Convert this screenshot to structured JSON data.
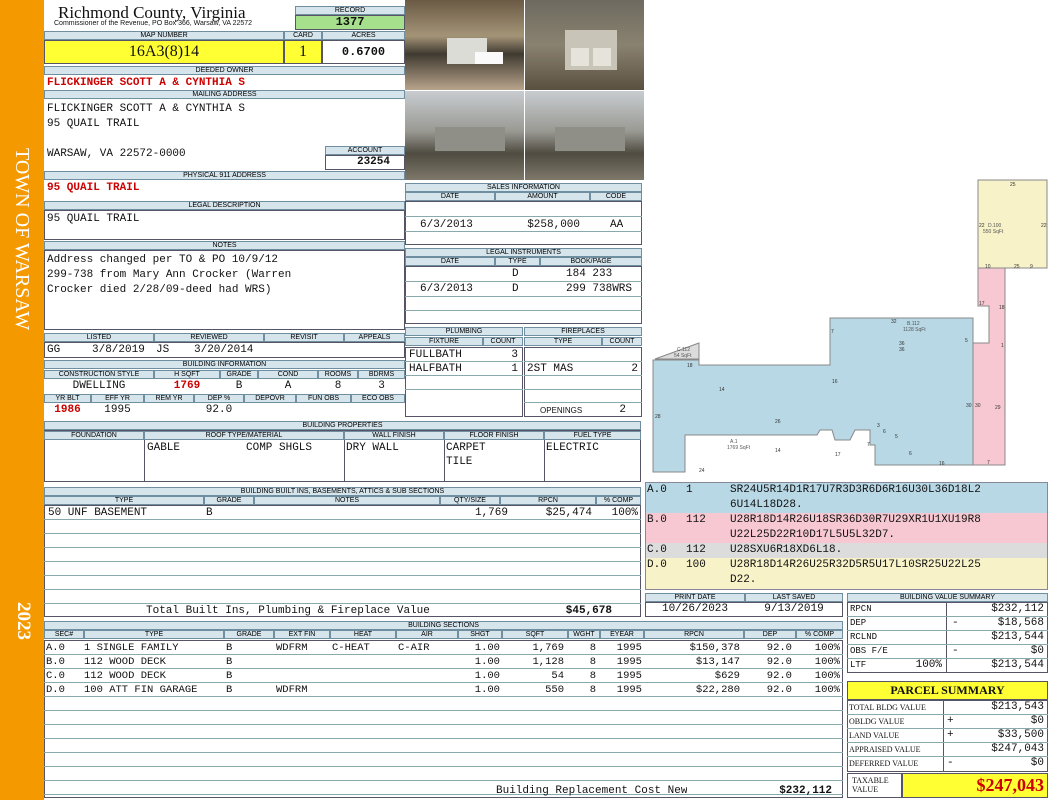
{
  "sidebar": {
    "town": "TOWN OF WARSAW",
    "year": "2023"
  },
  "header": {
    "county": "Richmond County, Virginia",
    "commissioner": "Commissioner of the Revenue, PO Box 366, Warsaw, VA 22572",
    "record_label": "RECORD",
    "record": "1377",
    "map_label": "MAP NUMBER",
    "map_number": "16A3(8)14",
    "card_label": "CARD",
    "card": "1",
    "acres_label": "ACRES",
    "acres": "0.6700"
  },
  "owner": {
    "label": "DEEDED OWNER",
    "name": "FLICKINGER SCOTT A & CYNTHIA S"
  },
  "mailing": {
    "label": "MAILING ADDRESS",
    "line1": "FLICKINGER SCOTT A & CYNTHIA S",
    "line2": "95 QUAIL TRAIL",
    "line3": "WARSAW, VA 22572-0000",
    "account_label": "ACCOUNT",
    "account": "23254"
  },
  "physical": {
    "label": "PHYSICAL 911 ADDRESS",
    "address": "95 QUAIL TRAIL"
  },
  "legal": {
    "label": "LEGAL DESCRIPTION",
    "text": "95 QUAIL TRAIL"
  },
  "notes": {
    "label": "NOTES",
    "lines": [
      "Address changed per TO & PO 10/9/12",
      "299-738 from Mary Ann Crocker (Warren",
      "Crocker died 2/28/09-deed had WRS)"
    ]
  },
  "sales": {
    "label": "SALES INFORMATION",
    "headers": [
      "DATE",
      "AMOUNT",
      "CODE"
    ],
    "rows": [
      {
        "date": "6/3/2013",
        "amount": "$258,000",
        "code": "AA"
      }
    ]
  },
  "legal_instruments": {
    "label": "LEGAL INSTRUMENTS",
    "headers": [
      "DATE",
      "TYPE",
      "BOOK/PAGE"
    ],
    "rows": [
      {
        "date": "",
        "type": "D",
        "book": "184 233"
      },
      {
        "date": "6/3/2013",
        "type": "D",
        "book": "299 738WRS"
      }
    ]
  },
  "listed": {
    "listed_label": "LISTED",
    "reviewed_label": "REVIEWED",
    "revisit_label": "REVISIT",
    "appeals_label": "APPEALS",
    "listed_by": "GG",
    "listed_date": "3/8/2019",
    "reviewed_by": "JS",
    "reviewed_date": "3/20/2014"
  },
  "building_info": {
    "label": "BUILDING INFORMATION",
    "h_style": "CONSTRUCTION STYLE",
    "h_sqft": "H SQFT",
    "h_grade": "GRADE",
    "h_cond": "COND",
    "h_rooms": "ROOMS",
    "h_bdrms": "BDRMS",
    "style": "DWELLING",
    "sqft": "1769",
    "grade": "B",
    "cond": "A",
    "rooms": "8",
    "bdrms": "3",
    "h_yrblt": "YR BLT",
    "h_effyr": "EFF YR",
    "h_remyr": "REM YR",
    "h_dep": "DEP %",
    "h_depovr": "DEPOVR",
    "h_funobs": "FUN OBS",
    "h_ecoobs": "ECO OBS",
    "yrblt": "1986",
    "effyr": "1995",
    "remyr": "",
    "dep": "92.0",
    "depovr": "",
    "funobs": "",
    "ecoobs": ""
  },
  "plumbing": {
    "label": "PLUMBING",
    "h_fixture": "FIXTURE",
    "h_count": "COUNT",
    "rows": [
      {
        "fixture": "FULLBATH",
        "count": "3"
      },
      {
        "fixture": "HALFBATH",
        "count": "1"
      }
    ]
  },
  "fireplaces": {
    "label": "FIREPLACES",
    "h_type": "TYPE",
    "h_count": "COUNT",
    "rows": [
      {
        "type": "2ST MAS",
        "count": "2"
      }
    ],
    "openings_label": "OPENINGS",
    "openings": "2"
  },
  "properties": {
    "label": "BUILDING PROPERTIES",
    "h_foundation": "FOUNDATION",
    "h_roof": "ROOF TYPE/MATERIAL",
    "h_wall": "WALL FINISH",
    "h_floor": "FLOOR FINISH",
    "h_fuel": "FUEL TYPE",
    "foundation": "",
    "roof_type": "GABLE",
    "roof_mat": "COMP SHGLS",
    "wall": "DRY WALL",
    "floor1": "CARPET",
    "floor2": "TILE",
    "fuel": "ELECTRIC"
  },
  "builtins": {
    "label": "BUILDING BUILT INS, BASEMENTS, ATTICS & SUB SECTIONS",
    "headers": {
      "type": "TYPE",
      "grade": "GRADE",
      "notes": "NOTES",
      "qty": "QTY/SIZE",
      "rpcn": "RPCN",
      "comp": "% COMP"
    },
    "rows": [
      {
        "type": "50 UNF BASEMENT",
        "grade": "B",
        "notes": "",
        "qty": "1,769",
        "rpcn": "$25,474",
        "comp": "100%"
      }
    ],
    "total_label": "Total Built Ins, Plumbing & Fireplace Value",
    "total": "$45,678"
  },
  "sketch": {
    "labels": {
      "a": "A.1",
      "a2": "1769 SqFt",
      "b": "B.112",
      "b2": "1128 SqFt",
      "c": "C.112",
      "c2": "54 SqFt",
      "d": "D.100",
      "d2": "550 SqFt"
    },
    "dims": {
      "d_top": "25",
      "d_left": "22",
      "d_right": "22",
      "d_b1": "10",
      "d_b2": "25",
      "d_b3": "9",
      "b_top": "32",
      "b_r1": "17",
      "b_r2": "18",
      "b_l": "7",
      "b_36a": "36",
      "b_36b": "36",
      "b_5": "5",
      "b_1": "1",
      "b_30a": "30",
      "b_30b": "30",
      "b_29": "29",
      "b_16": "16",
      "b_7": "7",
      "c_18": "18",
      "a_14": "14",
      "a_26": "26",
      "a_28": "28",
      "a_24": "24",
      "a_14b": "14",
      "a_17": "17",
      "a_7": "7",
      "a_3": "3",
      "a_6": "6",
      "a_5": "5",
      "a_6b": "6",
      "a_18": "18",
      "a_16": "16"
    }
  },
  "vectors": [
    {
      "sec": "A.0",
      "code": "1",
      "text": "SR24U5R14D1R17U7R3D3R6D6R16U30L36D18L2",
      "text2": "6U14L18D28.",
      "color": "#b8d8e6"
    },
    {
      "sec": "B.0",
      "code": "112",
      "text": "U28R18D14R26U18SR36D30R7U29XR1U1XU19R8",
      "text2": "U22L25D22R10D17L5U5L32D7.",
      "color": "#f7c8d2"
    },
    {
      "sec": "C.0",
      "code": "112",
      "text": "U28SXU6R18XD6L18.",
      "text2": "",
      "color": "#dcdcdc"
    },
    {
      "sec": "D.0",
      "code": "100",
      "text": "U28R18D14R26U25R32D5R5U17L10SR25U22L25",
      "text2": "D22.",
      "color": "#f7f2c8"
    }
  ],
  "dates": {
    "print_label": "PRINT DATE",
    "print": "10/26/2023",
    "saved_label": "LAST SAVED",
    "saved": "9/13/2019"
  },
  "bvs": {
    "label": "BUILDING VALUE SUMMARY",
    "rows": [
      {
        "k": "RPCN",
        "s": "",
        "v": "$232,112"
      },
      {
        "k": "DEP",
        "s": "-",
        "v": "$18,568"
      },
      {
        "k": "RCLND",
        "s": "",
        "v": "$213,544"
      },
      {
        "k": "OBS F/E",
        "s": "-",
        "v": "$0"
      },
      {
        "k": "LTF",
        "p": "100%",
        "s": "",
        "v": "$213,544"
      }
    ]
  },
  "sections": {
    "label": "BUILDING SECTIONS",
    "headers": [
      "SEC#",
      "TYPE",
      "GRADE",
      "EXT FIN",
      "HEAT",
      "AIR",
      "SHGT",
      "SQFT",
      "WGHT",
      "EYEAR",
      "RPCN",
      "DEP",
      "% COMP"
    ],
    "rows": [
      [
        "A.0",
        "1 SINGLE FAMILY",
        "B",
        "WDFRM",
        "C-HEAT",
        "C-AIR",
        "1.00",
        "1,769",
        "8",
        "1995",
        "$150,378",
        "92.0",
        "100%"
      ],
      [
        "B.0",
        "112 WOOD DECK",
        "B",
        "",
        "",
        "",
        "1.00",
        "1,128",
        "8",
        "1995",
        "$13,147",
        "92.0",
        "100%"
      ],
      [
        "C.0",
        "112 WOOD DECK",
        "B",
        "",
        "",
        "",
        "1.00",
        "54",
        "8",
        "1995",
        "$629",
        "92.0",
        "100%"
      ],
      [
        "D.0",
        "100 ATT FIN GARAGE",
        "B",
        "WDFRM",
        "",
        "",
        "1.00",
        "550",
        "8",
        "1995",
        "$22,280",
        "92.0",
        "100%"
      ]
    ],
    "total_label": "Building Replacement Cost New",
    "total": "$232,112"
  },
  "parcel": {
    "label": "PARCEL SUMMARY",
    "rows": [
      {
        "k": "TOTAL BLDG VALUE",
        "s": "",
        "v": "$213,543"
      },
      {
        "k": "OBLDG VALUE",
        "s": "+",
        "v": "$0"
      },
      {
        "k": "LAND VALUE",
        "s": "+",
        "v": "$33,500"
      },
      {
        "k": "APPRAISED VALUE",
        "s": "",
        "v": "$247,043"
      },
      {
        "k": "DEFERRED VALUE",
        "s": "-",
        "v": "$0"
      }
    ],
    "taxable_label1": "TAXABLE",
    "taxable_label2": "VALUE",
    "taxable": "$247,043"
  },
  "colors": {
    "sidebar": "#f49a00",
    "header_blue": "#d6e4ec",
    "yellow": "#ffff33",
    "green_record": "#a6e08c",
    "red_text": "#cc0000"
  }
}
